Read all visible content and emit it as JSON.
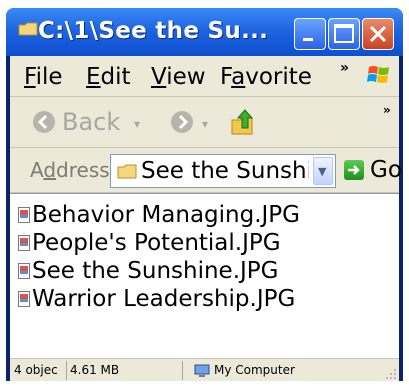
{
  "window": {
    "title": "C:\\1\\See the Su..."
  },
  "menubar": {
    "items": [
      {
        "label_acc": "F",
        "label_rest": "ile"
      },
      {
        "label_acc": "E",
        "label_rest": "dit"
      },
      {
        "label_acc": "V",
        "label_rest": "iew"
      },
      {
        "label_pre": "F",
        "label_acc": "a",
        "label_rest": "vorite"
      }
    ]
  },
  "toolbar": {
    "back_label": "Back"
  },
  "address": {
    "label_pre": "A",
    "label_acc": "d",
    "label_rest": "dress",
    "value": "See the Sunshine",
    "go_label": "Go"
  },
  "files": [
    {
      "name": "Behavior Managing.JPG"
    },
    {
      "name": "People's Potential.JPG"
    },
    {
      "name": "See the Sunshine.JPG"
    },
    {
      "name": "Warrior Leadership.JPG"
    }
  ],
  "status": {
    "count": "4 objec",
    "size": "4.61 MB",
    "location": "My Computer"
  },
  "colors": {
    "titlebar": "#1f64e0",
    "close": "#c9431e",
    "chrome": "#ece9d8"
  }
}
